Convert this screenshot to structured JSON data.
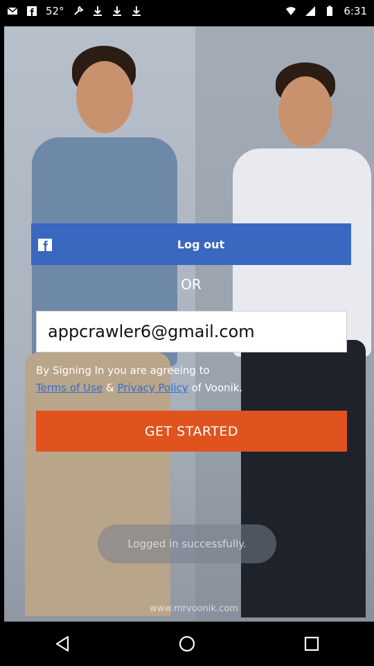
{
  "status_bar": {
    "time": "6:31",
    "temperature": "52°"
  },
  "facebook_button": {
    "label": "Log out",
    "icon": "facebook-icon"
  },
  "divider": {
    "label": "OR"
  },
  "email_field": {
    "value": "appcrawler6@gmail.com"
  },
  "terms": {
    "line1": "By Signing In you are agreeing to",
    "terms_link": "Terms of Use",
    "ampersand": "&",
    "privacy_link": "Privacy Policy",
    "suffix": "of Voonik."
  },
  "cta": {
    "label": "GET STARTED"
  },
  "toast": {
    "message": "Logged in successfully."
  },
  "footer": {
    "url": "www.mrvoonik.com"
  },
  "colors": {
    "facebook": "#3a67c0",
    "cta": "#e0531f",
    "link": "#2f6fd1"
  }
}
